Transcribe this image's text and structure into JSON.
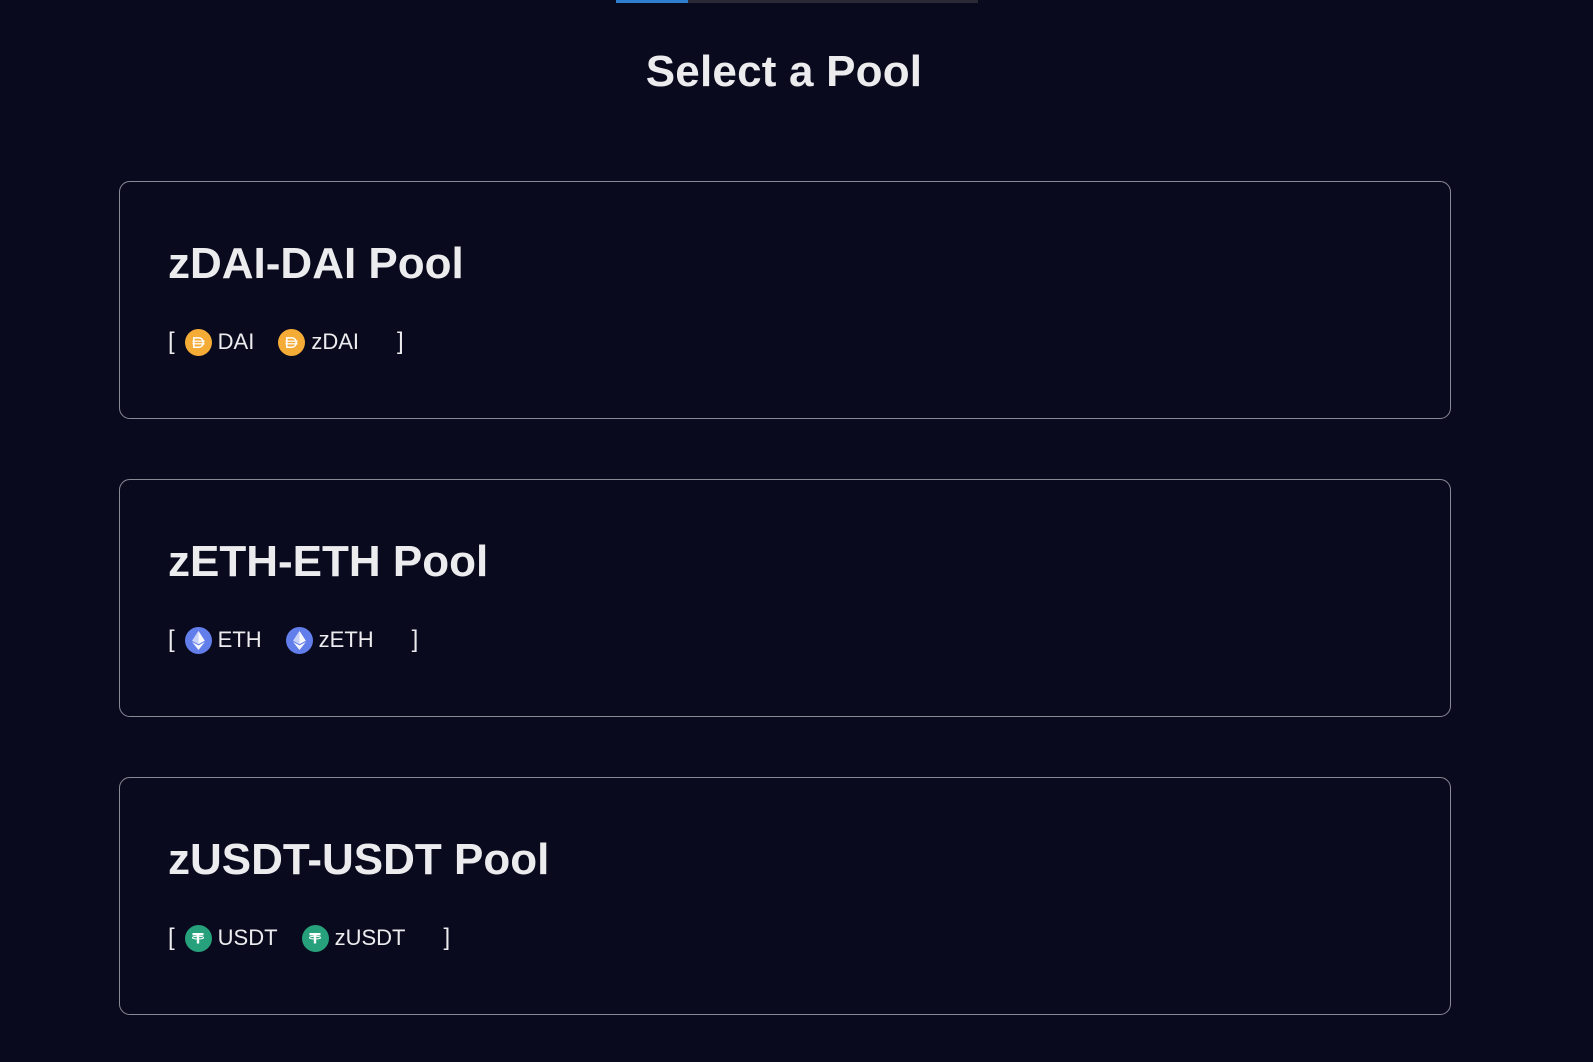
{
  "header": {
    "title": "Select a Pool",
    "progress_fraction": 0.2
  },
  "pools": [
    {
      "name": "zDAI-DAI Pool",
      "tokens": [
        {
          "symbol": "DAI",
          "icon": "dai-icon",
          "color": "#f5ac37"
        },
        {
          "symbol": "zDAI",
          "icon": "dai-icon",
          "color": "#f5ac37"
        }
      ]
    },
    {
      "name": "zETH-ETH Pool",
      "tokens": [
        {
          "symbol": "ETH",
          "icon": "eth-icon",
          "color": "#627eea"
        },
        {
          "symbol": "zETH",
          "icon": "eth-icon",
          "color": "#627eea"
        }
      ]
    },
    {
      "name": "zUSDT-USDT Pool",
      "tokens": [
        {
          "symbol": "USDT",
          "icon": "usdt-icon",
          "color": "#26a17b"
        },
        {
          "symbol": "zUSDT",
          "icon": "usdt-icon",
          "color": "#26a17b"
        }
      ]
    }
  ],
  "punctuation": {
    "open_bracket": "[",
    "close_bracket": "]"
  },
  "colors": {
    "background": "#0a0a1e",
    "card_border": "#8a8a96",
    "progress_fill": "#2f7fd1",
    "text": "#ececef"
  }
}
